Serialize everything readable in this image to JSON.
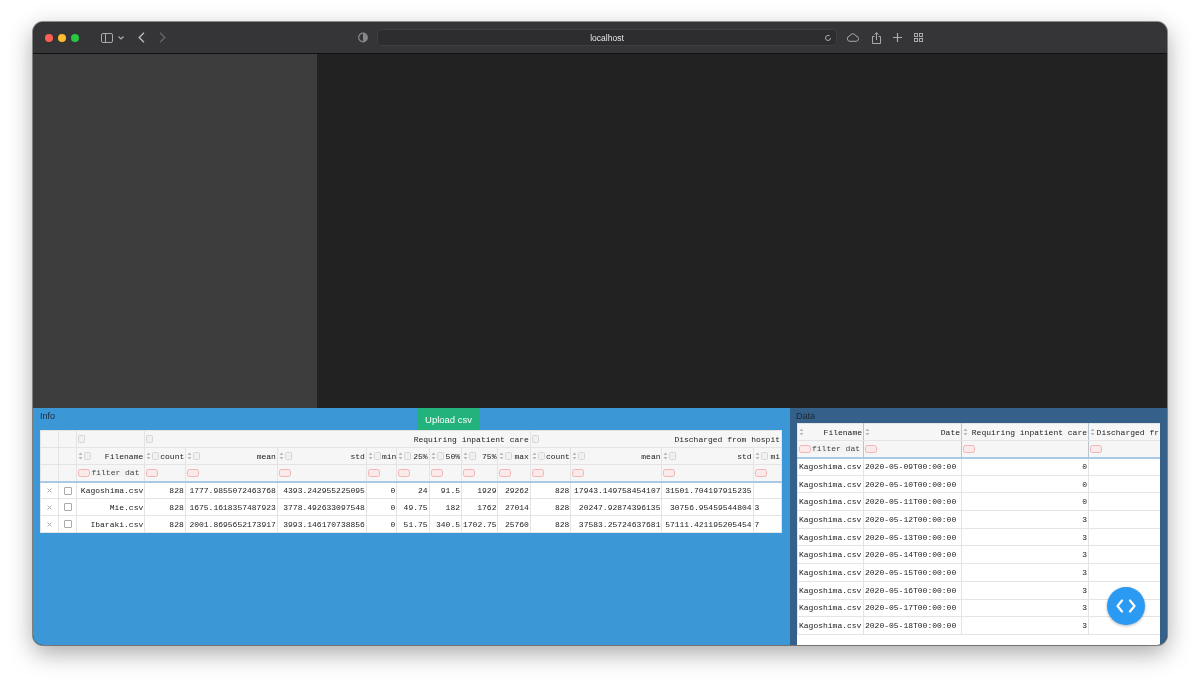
{
  "browser": {
    "address": "localhost"
  },
  "info_panel": {
    "title": "Info",
    "upload_button": "Upload csv",
    "key_column": "Filename",
    "groups": [
      {
        "label": "Requiring inpatient care",
        "columns": [
          "count",
          "mean",
          "std",
          "min",
          "25%",
          "50%",
          "75%",
          "max"
        ]
      },
      {
        "label": "Discharged from hospit",
        "columns": [
          "count",
          "mean",
          "std",
          "mi"
        ]
      }
    ],
    "filter_placeholder": "filter dat",
    "rows": [
      {
        "checked": false,
        "cells": [
          "Kagoshima.csv",
          "828",
          "1777.9855072463768",
          "4393.242955225095",
          "0",
          "24",
          "91.5",
          "1929",
          "29262",
          "828",
          "17943.149758454107",
          "31501.704197915235"
        ]
      },
      {
        "checked": false,
        "cells": [
          "Mie.csv",
          "828",
          "1675.1618357487923",
          "3778.492633097548",
          "0",
          "49.75",
          "182",
          "1762",
          "27014",
          "828",
          "20247.92874396135",
          "30756.95459544804",
          "3"
        ]
      },
      {
        "checked": false,
        "cells": [
          "Ibaraki.csv",
          "828",
          "2001.8695652173917",
          "3993.146170738856",
          "0",
          "51.75",
          "340.5",
          "1702.75",
          "25760",
          "828",
          "37583.25724637681",
          "57111.421195205454",
          "7"
        ]
      }
    ]
  },
  "data_panel": {
    "title": "Data",
    "columns": [
      "Filename",
      "Date",
      "Requiring inpatient care",
      "Discharged fr"
    ],
    "filter_placeholder": "filter dat",
    "rows": [
      [
        "Kagoshima.csv",
        "2020-05-09T00:00:00",
        "0"
      ],
      [
        "Kagoshima.csv",
        "2020-05-10T00:00:00",
        "0"
      ],
      [
        "Kagoshima.csv",
        "2020-05-11T00:00:00",
        "0"
      ],
      [
        "Kagoshima.csv",
        "2020-05-12T00:00:00",
        "3"
      ],
      [
        "Kagoshima.csv",
        "2020-05-13T00:00:00",
        "3"
      ],
      [
        "Kagoshima.csv",
        "2020-05-14T00:00:00",
        "3"
      ],
      [
        "Kagoshima.csv",
        "2020-05-15T00:00:00",
        "3"
      ],
      [
        "Kagoshima.csv",
        "2020-05-16T00:00:00",
        "3"
      ],
      [
        "Kagoshima.csv",
        "2020-05-17T00:00:00",
        "3"
      ],
      [
        "Kagoshima.csv",
        "2020-05-18T00:00:00",
        "3"
      ]
    ]
  }
}
